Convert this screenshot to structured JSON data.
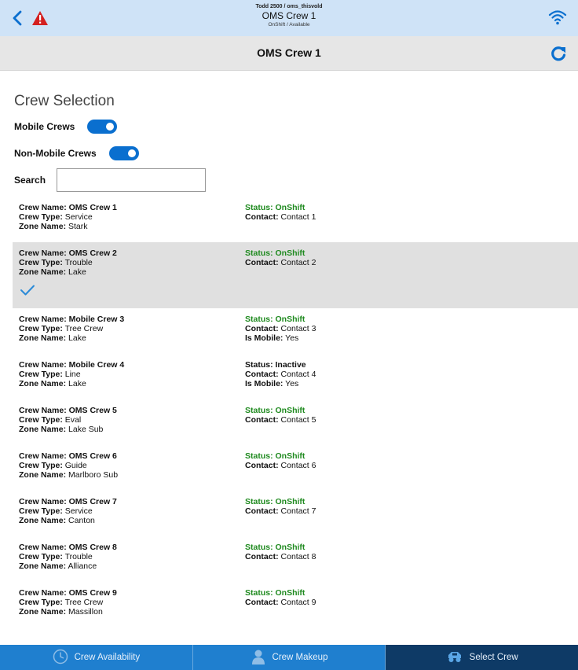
{
  "header": {
    "user": "Todd 2500 / oms_thisvold",
    "crew": "OMS Crew 1",
    "status": "OnShift / Available"
  },
  "titlebar": {
    "title": "OMS Crew 1"
  },
  "main": {
    "heading": "Crew Selection",
    "mobile_label": "Mobile Crews",
    "mobile_on": true,
    "nonmobile_label": "Non-Mobile Crews",
    "nonmobile_on": true,
    "search_label": "Search",
    "search_value": ""
  },
  "labels": {
    "crew_name": "Crew Name:",
    "crew_type": "Crew Type:",
    "zone_name": "Zone Name:",
    "status": "Status:",
    "contact": "Contact:",
    "is_mobile": "Is Mobile:"
  },
  "crews": [
    {
      "name": "OMS Crew 1",
      "type": "Service",
      "zone": "Stark",
      "status": "OnShift",
      "contact": "Contact 1",
      "mobile": null,
      "selected": false
    },
    {
      "name": "OMS Crew 2",
      "type": "Trouble",
      "zone": "Lake",
      "status": "OnShift",
      "contact": "Contact 2",
      "mobile": null,
      "selected": true
    },
    {
      "name": "Mobile Crew 3",
      "type": "Tree Crew",
      "zone": "Lake",
      "status": "OnShift",
      "contact": "Contact 3",
      "mobile": "Yes",
      "selected": false
    },
    {
      "name": "Mobile Crew 4",
      "type": "Line",
      "zone": "Lake",
      "status": "Inactive",
      "contact": "Contact 4",
      "mobile": "Yes",
      "selected": false
    },
    {
      "name": "OMS Crew 5",
      "type": "Eval",
      "zone": "Lake Sub",
      "status": "OnShift",
      "contact": "Contact 5",
      "mobile": null,
      "selected": false
    },
    {
      "name": "OMS Crew 6",
      "type": "Guide",
      "zone": "Marlboro Sub",
      "status": "OnShift",
      "contact": "Contact 6",
      "mobile": null,
      "selected": false
    },
    {
      "name": "OMS Crew 7",
      "type": "Service",
      "zone": "Canton",
      "status": "OnShift",
      "contact": "Contact 7",
      "mobile": null,
      "selected": false
    },
    {
      "name": "OMS Crew 8",
      "type": "Trouble",
      "zone": "Alliance",
      "status": "OnShift",
      "contact": "Contact 8",
      "mobile": null,
      "selected": false
    },
    {
      "name": "OMS Crew 9",
      "type": "Tree Crew",
      "zone": "Massillon",
      "status": "OnShift",
      "contact": "Contact 9",
      "mobile": null,
      "selected": false
    }
  ],
  "bottomnav": {
    "tabs": [
      {
        "label": "Crew Availability",
        "icon": "clock-icon",
        "active": false
      },
      {
        "label": "Crew Makeup",
        "icon": "person-icon",
        "active": false
      },
      {
        "label": "Select Crew",
        "icon": "truck-icon",
        "active": true
      }
    ]
  },
  "colors": {
    "header_bg": "#cfe3f7",
    "accent": "#0a6fcf",
    "onshift": "#1f8a1f",
    "nav": "#1f7fcf",
    "nav_active": "#0e3a66",
    "alert": "#d42020"
  }
}
